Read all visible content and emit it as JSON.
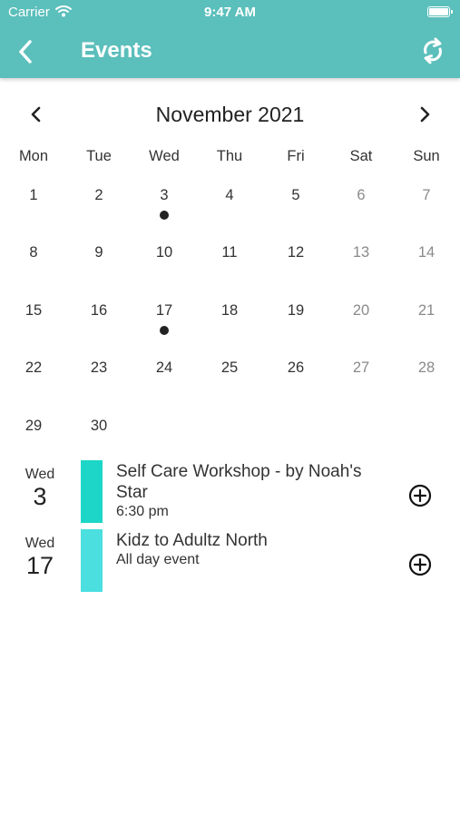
{
  "status_bar": {
    "carrier": "Carrier",
    "time": "9:47 AM"
  },
  "header": {
    "title": "Events",
    "background": "#5bbfbb"
  },
  "calendar": {
    "month_label": "November 2021",
    "weekdays": [
      "Mon",
      "Tue",
      "Wed",
      "Thu",
      "Fri",
      "Sat",
      "Sun"
    ],
    "weeks": [
      [
        "1",
        "2",
        "3",
        "4",
        "5",
        "6",
        "7"
      ],
      [
        "8",
        "9",
        "10",
        "11",
        "12",
        "13",
        "14"
      ],
      [
        "15",
        "16",
        "17",
        "18",
        "19",
        "20",
        "21"
      ],
      [
        "22",
        "23",
        "24",
        "25",
        "26",
        "27",
        "28"
      ],
      [
        "29",
        "30",
        "",
        "",
        "",
        "",
        ""
      ]
    ],
    "event_days": [
      "3",
      "17"
    ]
  },
  "events": [
    {
      "weekday": "Wed",
      "day": "3",
      "title": "Self Care Workshop - by Noah's Star",
      "time": "6:30 pm",
      "color": "#1dd6c8"
    },
    {
      "weekday": "Wed",
      "day": "17",
      "title": "Kidz to Adultz North",
      "time": "All day event",
      "color": "#4bdfe0"
    }
  ]
}
